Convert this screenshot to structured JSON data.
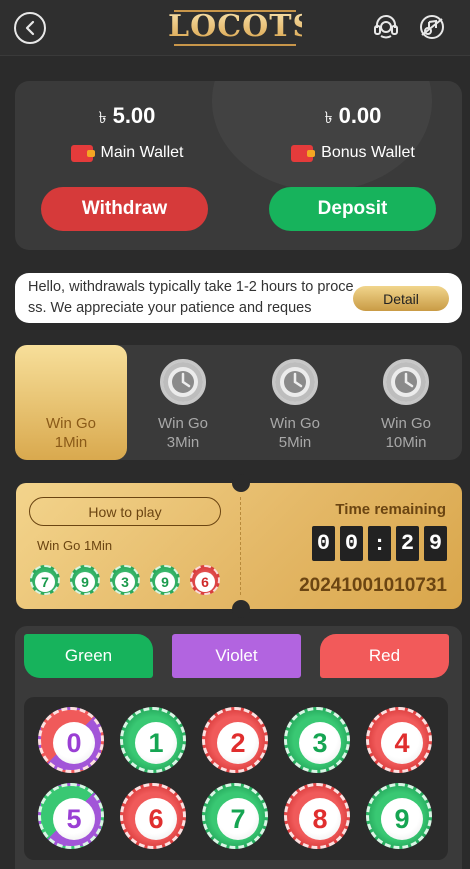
{
  "header": {
    "logo_text": "LOCOTS",
    "back_icon": "back-arrow-icon",
    "support_icon": "headset-icon",
    "sound_icon": "sound-off-icon"
  },
  "wallet": {
    "main": {
      "currency": "৳",
      "amount": "5.00",
      "label": "Main Wallet"
    },
    "bonus": {
      "currency": "৳",
      "amount": "0.00",
      "label": "Bonus Wallet"
    },
    "withdraw_label": "Withdraw",
    "deposit_label": "Deposit"
  },
  "notice": {
    "text": "Hello, withdrawals typically take 1-2 hours to process. We appreciate your patience and reques",
    "detail_label": "Detail"
  },
  "tabs": [
    {
      "line1": "Win Go",
      "line2": "1Min",
      "active": true
    },
    {
      "line1": "Win Go",
      "line2": "3Min",
      "active": false
    },
    {
      "line1": "Win Go",
      "line2": "5Min",
      "active": false
    },
    {
      "line1": "Win Go",
      "line2": "10Min",
      "active": false
    }
  ],
  "timer": {
    "how_to_play": "How to play",
    "game_name": "Win Go 1Min",
    "recent_results": [
      {
        "num": "7",
        "color": "green"
      },
      {
        "num": "9",
        "color": "green"
      },
      {
        "num": "3",
        "color": "green"
      },
      {
        "num": "9",
        "color": "green"
      },
      {
        "num": "6",
        "color": "red"
      }
    ],
    "time_label": "Time remaining",
    "digits": [
      "0",
      "0",
      ":",
      "2",
      "9"
    ],
    "period": "20241001010731"
  },
  "bet": {
    "green_label": "Green",
    "violet_label": "Violet",
    "red_label": "Red",
    "numbers": [
      "0",
      "1",
      "2",
      "3",
      "4",
      "5",
      "6",
      "7",
      "8",
      "9"
    ]
  },
  "colors": {
    "green": "#17b35c",
    "red": "#d63a3a",
    "violet": "#b264e0",
    "gold": "#e4b867"
  }
}
